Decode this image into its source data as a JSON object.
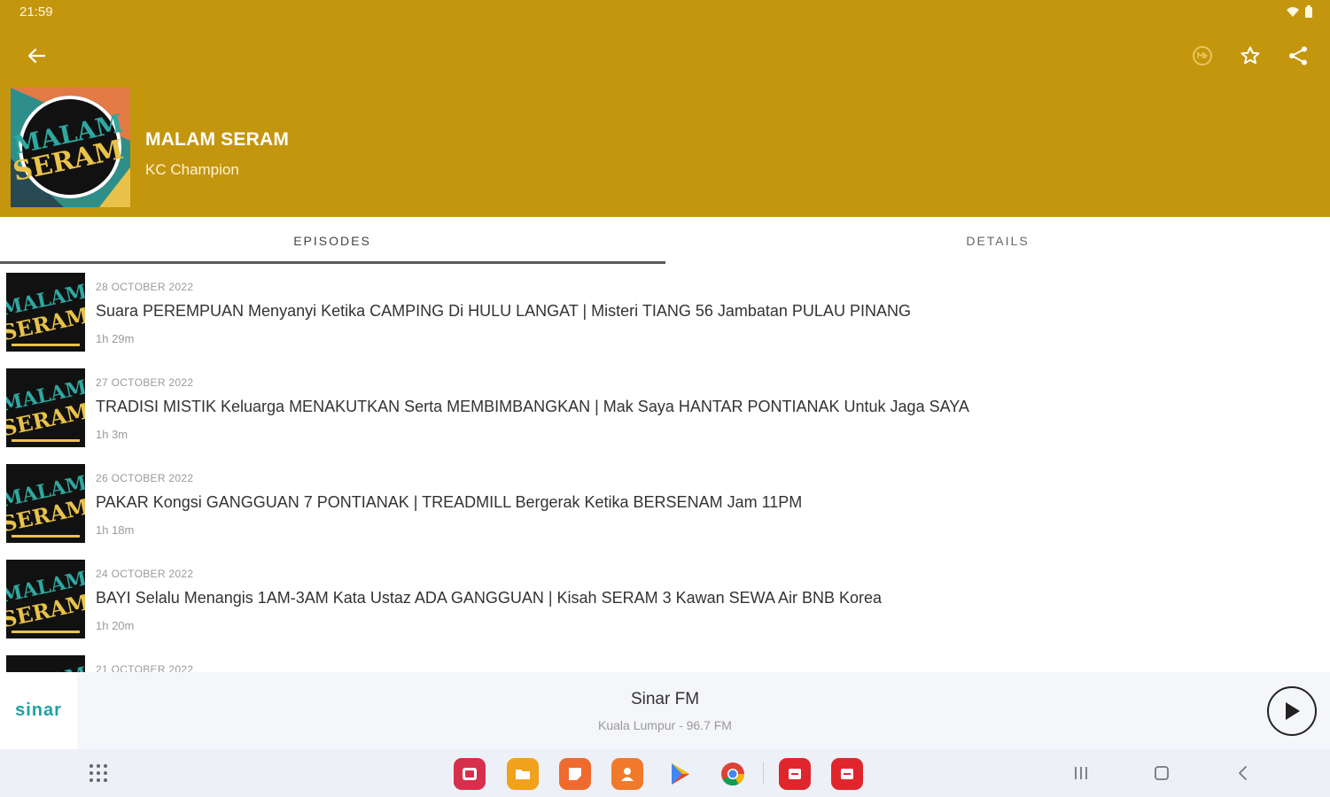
{
  "status_bar": {
    "time": "21:59"
  },
  "header": {
    "title": "MALAM SERAM",
    "author": "KC Champion",
    "accent_color": "#c4960e",
    "icons": [
      "back-arrow-icon",
      "auto-download-icon",
      "star-icon",
      "share-icon"
    ]
  },
  "tabs": [
    {
      "label": "EPISODES",
      "selected": true
    },
    {
      "label": "DETAILS",
      "selected": false
    }
  ],
  "episodes": [
    {
      "date": "28 OCTOBER 2022",
      "title": "Suara PEREMPUAN Menyanyi Ketika CAMPING Di HULU LANGAT | Misteri TIANG 56 Jambatan PULAU PINANG",
      "duration": "1h 29m"
    },
    {
      "date": "27 OCTOBER 2022",
      "title": "TRADISI MISTIK Keluarga MENAKUTKAN Serta MEMBIMBANGKAN | Mak Saya HANTAR PONTIANAK Untuk Jaga SAYA",
      "duration": "1h 3m"
    },
    {
      "date": "26 OCTOBER 2022",
      "title": "PAKAR Kongsi GANGGUAN 7 PONTIANAK | TREADMILL Bergerak Ketika BERSENAM Jam 11PM",
      "duration": "1h 18m"
    },
    {
      "date": "24 OCTOBER 2022",
      "title": "BAYI Selalu Menangis 1AM-3AM Kata Ustaz ADA GANGGUAN | Kisah SERAM 3 Kawan SEWA Air BNB Korea",
      "duration": "1h 20m"
    },
    {
      "date": "21 OCTOBER 2022",
      "title": "",
      "duration": ""
    }
  ],
  "player": {
    "logo_text": "sinar",
    "station": "Sinar FM",
    "subtitle": "Kuala Lumpur - 96.7 FM"
  },
  "taskbar": {
    "apps": [
      "gallery-app",
      "my-files-app",
      "notes-app",
      "contacts-app",
      "play-store-app",
      "chrome-app",
      "castbox-app",
      "castbox-app-2"
    ]
  }
}
